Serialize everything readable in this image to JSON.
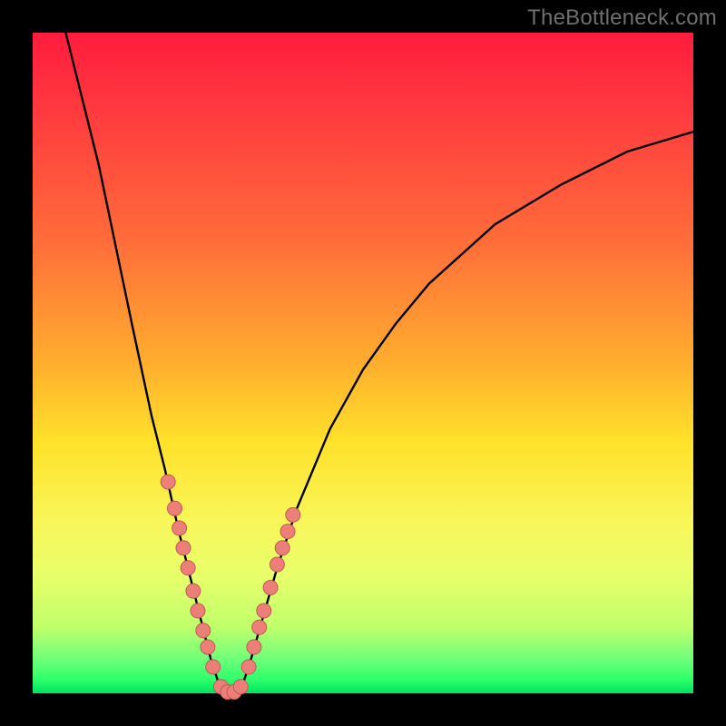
{
  "watermark": {
    "text": "TheBottleneck.com"
  },
  "colors": {
    "frame": "#000000",
    "curve": "#000000",
    "dot_fill": "#ec7f78",
    "dot_stroke": "#c15a55"
  },
  "chart_data": {
    "type": "line",
    "title": "",
    "xlabel": "",
    "ylabel": "",
    "xlim": [
      0,
      100
    ],
    "ylim": [
      0,
      100
    ],
    "grid": false,
    "legend": false,
    "description": "V-shaped bottleneck curve on a rainbow background. The vertical axis encodes bottleneck percentage (100 at top, 0 at bottom). The curve dips to ~0 near x≈30 and rises on both sides. Coral dots mark sampled points near the trough on both arms.",
    "series": [
      {
        "name": "bottleneck-curve",
        "x": [
          5,
          10,
          15,
          18,
          20,
          22,
          24,
          26,
          27,
          28,
          29,
          30,
          31,
          32,
          33,
          35,
          37,
          40,
          45,
          50,
          55,
          60,
          70,
          80,
          90,
          100
        ],
        "y": [
          100,
          80,
          56,
          42,
          34,
          25,
          17,
          9,
          5,
          2,
          0.5,
          0,
          0.5,
          2,
          5,
          12,
          19,
          28,
          40,
          49,
          56,
          62,
          71,
          77,
          82,
          85
        ]
      },
      {
        "name": "sample-dots-left",
        "x": [
          20.5,
          21.5,
          22.2,
          22.8,
          23.5,
          24.3,
          25.0,
          25.8,
          26.5,
          27.3
        ],
        "y": [
          32,
          28,
          25,
          22,
          19,
          15.5,
          12.5,
          9.5,
          7,
          4
        ]
      },
      {
        "name": "sample-dots-right",
        "x": [
          32.7,
          33.5,
          34.3,
          35.0,
          36.0,
          37.0,
          37.8,
          38.6,
          39.4
        ],
        "y": [
          4,
          7,
          10,
          12.5,
          16,
          19.5,
          22,
          24.5,
          27
        ]
      },
      {
        "name": "sample-dots-trough",
        "x": [
          28.5,
          29.5,
          30.5,
          31.5
        ],
        "y": [
          1,
          0.2,
          0.2,
          1
        ]
      }
    ]
  }
}
